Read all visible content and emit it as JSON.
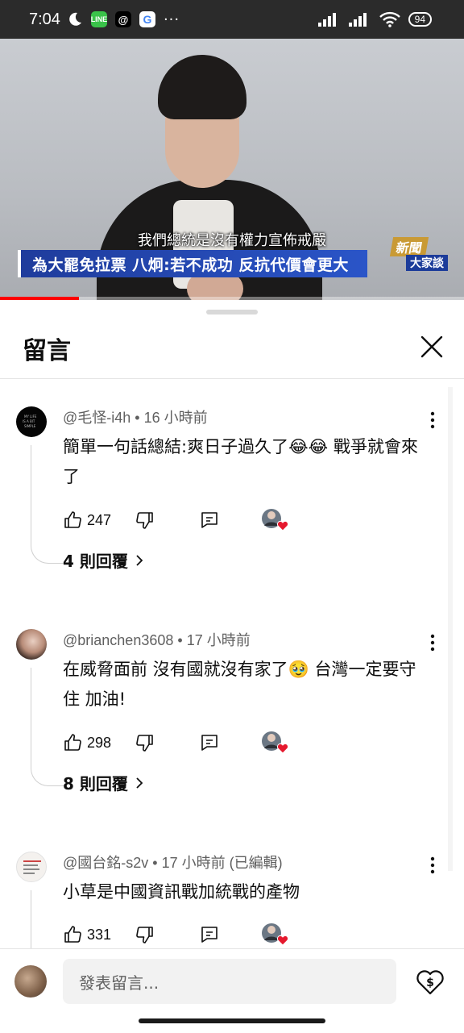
{
  "status_bar": {
    "time": "7:04",
    "battery": "94",
    "app_icons": [
      "moon-icon",
      "line-icon",
      "threads-icon",
      "google-icon",
      "more-dots-icon"
    ]
  },
  "video": {
    "subtitle": "我們總統是沒有權力宣佈戒嚴",
    "headline": "為大罷免拉票 八炯:若不成功 反抗代價會更大",
    "logo_top": "新聞",
    "logo_bottom": "大家談",
    "progress_fraction": 0.17
  },
  "sheet": {
    "title": "留言",
    "close_icon": "close-icon"
  },
  "comments": [
    {
      "author": "@毛怪-i4h",
      "time": "16 小時前",
      "text": "簡單一句話總結:爽日子過久了😂😂 戰爭就會來了",
      "likes": "247",
      "replies": "4 則回覆"
    },
    {
      "author": "@brianchen3608",
      "time": "17 小時前",
      "text": "在威脅面前 沒有國就沒有家了🥹 台灣一定要守住 加油!",
      "likes": "298",
      "replies": "8 則回覆"
    },
    {
      "author": "@國台銘-s2v",
      "time": "17 小時前 (已編輯)",
      "text": "小草是中國資訊戰加統戰的產物",
      "likes": "331",
      "replies": ""
    }
  ],
  "composer": {
    "placeholder": "發表留言..."
  },
  "colors": {
    "accent_red": "#ff0000",
    "headline_blue": "#1f3c9c",
    "heart_red": "#e5192e"
  }
}
